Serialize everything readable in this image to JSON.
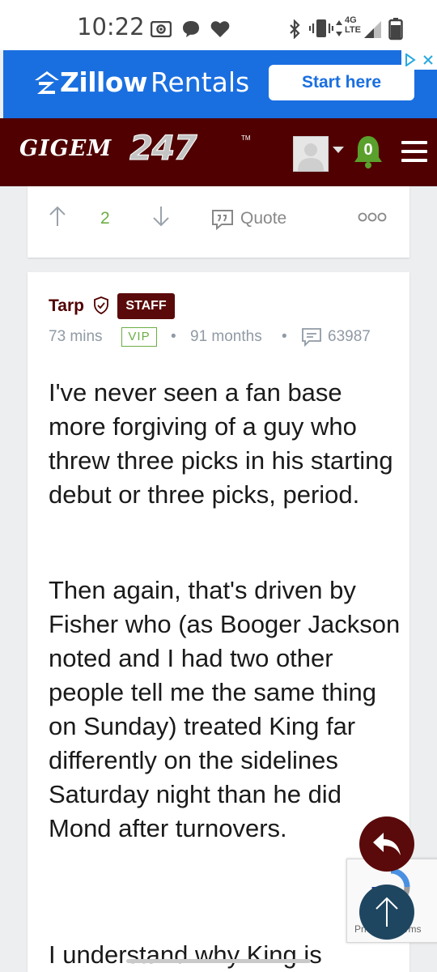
{
  "status_bar": {
    "time": "10:22",
    "network": "4G LTE",
    "icons": [
      "screen-record-icon",
      "chat-bubble-icon",
      "heart-icon",
      "bluetooth-icon",
      "vibrate-icon",
      "signal-icon",
      "battery-icon"
    ]
  },
  "ad": {
    "brand": "Zillow",
    "brand_suffix": "Rentals",
    "cta": "Start here",
    "colors": {
      "background": "#1a6fe0",
      "cta_text": "#1a6fe0"
    }
  },
  "site": {
    "logo_main": "GIGEM",
    "logo_num": "247",
    "notification_count": "0",
    "colors": {
      "header": "#500000",
      "notify": "#5aa02c"
    }
  },
  "prev_post": {
    "vote_count": "2",
    "quote_label": "Quote"
  },
  "post": {
    "author": "Tarp",
    "badge": "STAFF",
    "time_ago": "73 mins",
    "vip": "VIP",
    "tenure": "91 months",
    "post_count": "63987",
    "paragraphs": [
      "I've never seen a fan base more forgiving of a guy who threw three picks in his starting debut or three picks, period.",
      "Then again, that's driven by Fisher who (as Booger Jackson noted and I had two other people tell me the same thing on Sunday) treated King far differently on the sidelines Saturday night than he did Mond after turnovers.",
      "I understand why King is"
    ]
  },
  "recaptcha": {
    "text": "Privacy - Terms"
  }
}
